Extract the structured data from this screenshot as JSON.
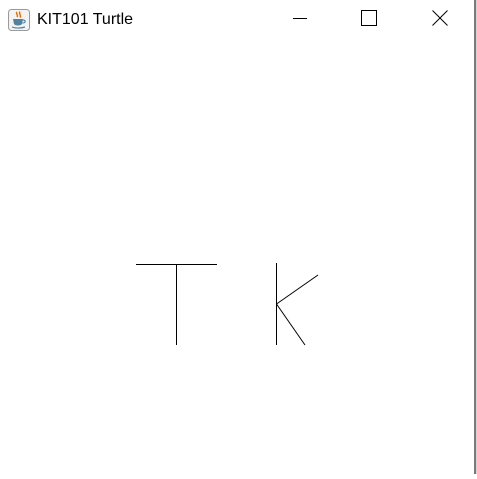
{
  "window": {
    "title": "KIT101 Turtle",
    "app_icon": "java-coffee-cup-icon",
    "controls": {
      "minimize_icon": "minimize-icon",
      "maximize_icon": "maximize-icon",
      "close_icon": "close-icon"
    }
  },
  "canvas": {
    "background": "#ffffff",
    "stroke_color": "#000000",
    "drawn_letters": [
      "T",
      "K"
    ]
  }
}
